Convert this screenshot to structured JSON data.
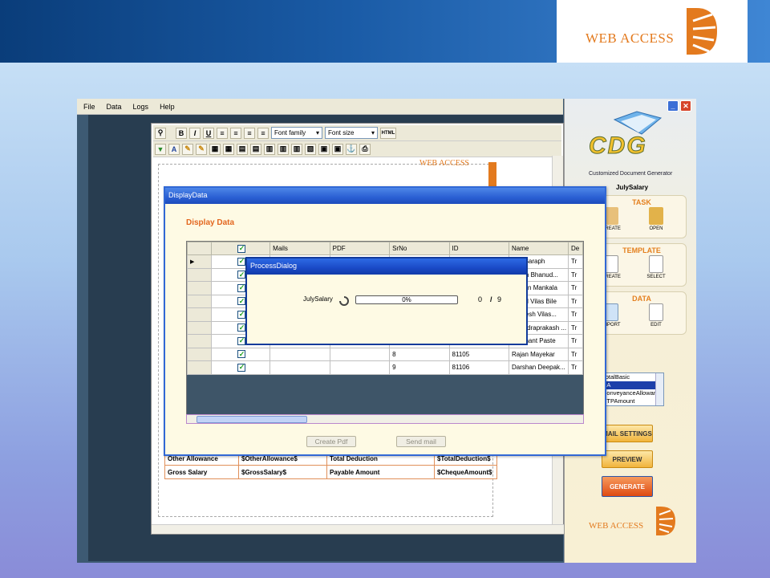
{
  "brand": {
    "name": "WEB ACCESS",
    "color": "#e37a1e"
  },
  "app": {
    "menu": [
      "File",
      "Data",
      "Logs",
      "Help"
    ],
    "editor_toolbar": {
      "font_family": "Font family",
      "font_size": "Font size",
      "bold": "B",
      "italic": "I",
      "underline": "U",
      "html": "HTML"
    },
    "doc_brand": "WEB ACCESS",
    "salary_grid": [
      [
        "Other Allowance",
        "$OtherAllowance$",
        "Total Deduction",
        "$TotalDeduction$"
      ],
      [
        "Gross Salary",
        "$GrossSalary$",
        "Payable Amount",
        "$ChequeAmount$"
      ]
    ]
  },
  "sidebar": {
    "logo": "CDG",
    "subtitle": "Customized Document Generator",
    "current_task": "JulySalary",
    "task": {
      "title": "TASK",
      "items": [
        "CREATE",
        "OPEN"
      ]
    },
    "template": {
      "title": "TEMPLATE",
      "items": [
        "CREATE",
        "SELECT"
      ]
    },
    "data": {
      "title": "DATA",
      "items": [
        "IMPORT",
        "EDIT"
      ]
    },
    "fields": [
      "TotalBasic",
      "DA",
      "ConveyanceAllowance",
      "HTPAmount"
    ],
    "selected_field_index": 1,
    "buttons": {
      "mail_settings": "MAIL SETTINGS",
      "preview": "PREVIEW",
      "generate": "GENERATE"
    },
    "footer_brand": "WEB ACCESS"
  },
  "display_data": {
    "window_title": "DisplayData",
    "heading": "Display Data",
    "columns": [
      "",
      "Mails",
      "PDF",
      "SrNo",
      "ID",
      "Name",
      "De"
    ],
    "rows": [
      {
        "checked": true,
        "srno": "",
        "id": "",
        "name": "Anil Saraph",
        "dept": "Tr"
      },
      {
        "checked": true,
        "srno": "",
        "id": "",
        "name": "Harsh Bhanud...",
        "dept": "Tr"
      },
      {
        "checked": true,
        "srno": "",
        "id": "",
        "name": "Mohan Mankala",
        "dept": "Tr"
      },
      {
        "checked": true,
        "srno": "",
        "id": "",
        "name": "Rahul Vilas Bile",
        "dept": "Tr"
      },
      {
        "checked": true,
        "srno": "",
        "id": "",
        "name": "Ramesh Vilas...",
        "dept": "Tr"
      },
      {
        "checked": true,
        "srno": "",
        "id": "",
        "name": "Chandraprakash ...",
        "dept": "Tr"
      },
      {
        "checked": true,
        "srno": "",
        "id": "",
        "name": "Prashant Paste",
        "dept": "Tr"
      },
      {
        "checked": true,
        "srno": "8",
        "id": "81105",
        "name": "Rajan Mayekar",
        "dept": "Tr"
      },
      {
        "checked": true,
        "srno": "9",
        "id": "81106",
        "name": "Darshan Deepak...",
        "dept": "Tr"
      }
    ],
    "buttons": {
      "create_pdf": "Create Pdf",
      "send_mail": "Send mail"
    }
  },
  "process_dialog": {
    "title": "ProcessDialog",
    "task_label": "JulySalary",
    "progress": 0,
    "progress_text": "0%",
    "count_done": "0",
    "separator": "/",
    "count_total": "9"
  }
}
